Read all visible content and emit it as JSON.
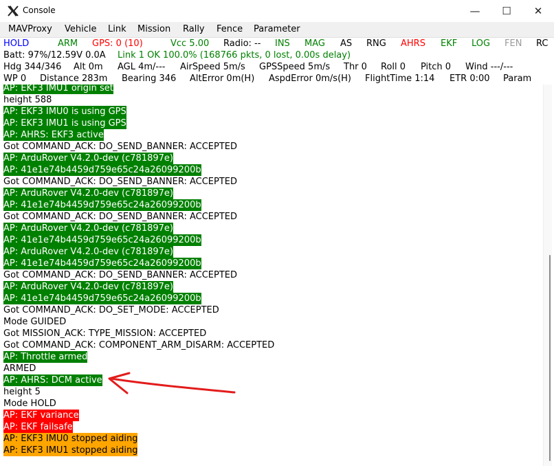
{
  "window": {
    "title": "Console",
    "minimize_glyph": "—",
    "maximize_glyph": "☐",
    "close_glyph": "✕"
  },
  "menu": [
    "MAVProxy",
    "Vehicle",
    "Link",
    "Mission",
    "Rally",
    "Fence",
    "Parameter"
  ],
  "status_row1": [
    {
      "text": "HOLD",
      "color": "blue"
    },
    {
      "text": "ARM",
      "color": "green"
    },
    {
      "text": "GPS: 0 (10)",
      "color": "red"
    },
    {
      "text": "Vcc 5.00",
      "color": "green"
    },
    {
      "text": "Radio: --",
      "color": "black"
    },
    {
      "text": "INS",
      "color": "green"
    },
    {
      "text": "MAG",
      "color": "green"
    },
    {
      "text": "AS",
      "color": "black"
    },
    {
      "text": "RNG",
      "color": "black"
    },
    {
      "text": "AHRS",
      "color": "red"
    },
    {
      "text": "EKF",
      "color": "green"
    },
    {
      "text": "LOG",
      "color": "green"
    },
    {
      "text": "FEN",
      "color": "grey"
    },
    {
      "text": "RC",
      "color": "black"
    }
  ],
  "status_row2": [
    {
      "text": "Batt: 97%/12.59V 0.0A",
      "color": "black"
    },
    {
      "text": "Link 1 OK 100.0% (168766 pkts, 0 lost, 0.00s delay)",
      "color": "green"
    }
  ],
  "status_row3": [
    {
      "text": "Hdg 344/346",
      "color": "black"
    },
    {
      "text": "Alt 0m",
      "color": "black"
    },
    {
      "text": "AGL 4m/---",
      "color": "black"
    },
    {
      "text": "AirSpeed 5m/s",
      "color": "black"
    },
    {
      "text": "GPSSpeed 5m/s",
      "color": "black"
    },
    {
      "text": "Thr 0",
      "color": "black"
    },
    {
      "text": "Roll 0",
      "color": "black"
    },
    {
      "text": "Pitch 0",
      "color": "black"
    },
    {
      "text": "Wind ---/---",
      "color": "black"
    }
  ],
  "status_row4": [
    {
      "text": "WP 0",
      "color": "black"
    },
    {
      "text": "Distance 283m",
      "color": "black"
    },
    {
      "text": "Bearing 346",
      "color": "black"
    },
    {
      "text": "AltError 0m(H)",
      "color": "black"
    },
    {
      "text": "AspdError 0m/s(H)",
      "color": "black"
    },
    {
      "text": "FlightTime 1:14",
      "color": "black"
    },
    {
      "text": "ETR 0:00",
      "color": "black"
    },
    {
      "text": "Param",
      "color": "black"
    }
  ],
  "console_lines": [
    {
      "text": "AP: EKF3 IMU1 origin set",
      "style": "green"
    },
    {
      "text": "height 588",
      "style": "plain"
    },
    {
      "text": "AP: EKF3 IMU0 is using GPS",
      "style": "green"
    },
    {
      "text": "AP: EKF3 IMU1 is using GPS",
      "style": "green"
    },
    {
      "text": "AP: AHRS: EKF3 active",
      "style": "green"
    },
    {
      "text": "Got COMMAND_ACK: DO_SEND_BANNER: ACCEPTED",
      "style": "plain"
    },
    {
      "text": "AP: ArduRover V4.2.0-dev (c781897e)",
      "style": "green"
    },
    {
      "text": "AP: 41e1e74b4459d759e65c24a26099200b",
      "style": "green"
    },
    {
      "text": "Got COMMAND_ACK: DO_SEND_BANNER: ACCEPTED",
      "style": "plain"
    },
    {
      "text": "AP: ArduRover V4.2.0-dev (c781897e)",
      "style": "green"
    },
    {
      "text": "AP: 41e1e74b4459d759e65c24a26099200b",
      "style": "green"
    },
    {
      "text": "Got COMMAND_ACK: DO_SEND_BANNER: ACCEPTED",
      "style": "plain"
    },
    {
      "text": "AP: ArduRover V4.2.0-dev (c781897e)",
      "style": "green"
    },
    {
      "text": "AP: 41e1e74b4459d759e65c24a26099200b",
      "style": "green"
    },
    {
      "text": "AP: ArduRover V4.2.0-dev (c781897e)",
      "style": "green"
    },
    {
      "text": "AP: 41e1e74b4459d759e65c24a26099200b",
      "style": "green"
    },
    {
      "text": "Got COMMAND_ACK: DO_SEND_BANNER: ACCEPTED",
      "style": "plain"
    },
    {
      "text": "AP: ArduRover V4.2.0-dev (c781897e)",
      "style": "green"
    },
    {
      "text": "AP: 41e1e74b4459d759e65c24a26099200b",
      "style": "green"
    },
    {
      "text": "Got COMMAND_ACK: DO_SET_MODE: ACCEPTED",
      "style": "plain"
    },
    {
      "text": "Mode GUIDED",
      "style": "plain"
    },
    {
      "text": "Got MISSION_ACK: TYPE_MISSION: ACCEPTED",
      "style": "plain"
    },
    {
      "text": "Got COMMAND_ACK: COMPONENT_ARM_DISARM: ACCEPTED",
      "style": "plain"
    },
    {
      "text": "AP: Throttle armed",
      "style": "green"
    },
    {
      "text": "ARMED",
      "style": "plain"
    },
    {
      "text": "AP: AHRS: DCM active",
      "style": "green"
    },
    {
      "text": "height 5",
      "style": "plain"
    },
    {
      "text": "Mode HOLD",
      "style": "plain"
    },
    {
      "text": "AP: EKF variance",
      "style": "red"
    },
    {
      "text": "AP: EKF failsafe",
      "style": "red"
    },
    {
      "text": "AP: EKF3 IMU0 stopped aiding",
      "style": "orange"
    },
    {
      "text": "AP: EKF3 IMU1 stopped aiding",
      "style": "orange"
    }
  ],
  "icons": {
    "app": "mavproxy-x-icon",
    "annotation": "red-arrow-annotation"
  }
}
